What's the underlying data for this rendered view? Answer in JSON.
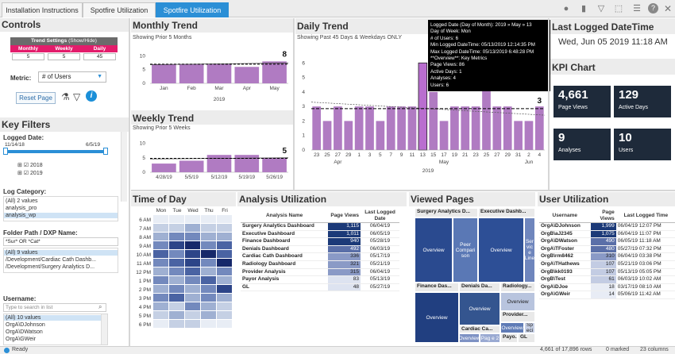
{
  "tabs": [
    {
      "label": "Installation Instructions"
    },
    {
      "label": "Spotfire Utilization v1.0"
    },
    {
      "label": "Spotfire Utilization v2.0"
    }
  ],
  "controls": {
    "title": "Controls",
    "trend_settings": "Trend Settings",
    "show_hide": "(Show/Hide)",
    "cols": [
      "Monthly",
      "Weekly",
      "Daily"
    ],
    "vals": [
      "5",
      "5",
      "45"
    ],
    "metric_label": "Metric:",
    "metric_value": "# of Users",
    "reset_label": "Reset Page"
  },
  "key_filters": {
    "title": "Key Filters",
    "logged_date_label": "Logged Date:",
    "date_from": "11/14/18",
    "date_to": "6/5/19",
    "years": [
      "2018",
      "2019"
    ],
    "log_category_label": "Log Category:",
    "log_category_items": [
      "(All) 2 values",
      "analysis_pro",
      "analysis_wp"
    ],
    "folder_label": "Folder Path / DXP Name:",
    "folder_search": "*Sur* OR *Cat*",
    "folder_items": [
      "(All) 9 values",
      "/Development/Cardiac Cath Dashb...",
      "/Development/Surgery Analytics D..."
    ],
    "username_label": "Username:",
    "username_placeholder": "Type to search in list",
    "username_items": [
      "(All) 10 values",
      "OrgA\\DJohnson",
      "OrgA\\DWatson",
      "OrgA\\GWeir"
    ]
  },
  "monthly": {
    "title": "Monthly Trend",
    "subtitle": "Showing Prior 5 Months",
    "chart_data": {
      "type": "bar",
      "categories": [
        "Jan",
        "Feb",
        "Mar",
        "Apr",
        "May"
      ],
      "values": [
        7,
        7,
        7,
        6,
        8
      ],
      "year": "2019",
      "yticks": [
        "10",
        "5",
        "0"
      ],
      "ylim": [
        0,
        11
      ],
      "last_label": "8"
    }
  },
  "weekly": {
    "title": "Weekly Trend",
    "subtitle": "Showing Prior 5 Weeks",
    "chart_data": {
      "type": "bar",
      "categories": [
        "4/28/19",
        "5/5/19",
        "5/12/19",
        "5/19/19",
        "5/26/19"
      ],
      "values": [
        3,
        4,
        6,
        6,
        5
      ],
      "yticks": [
        "10",
        "5",
        "0"
      ],
      "ylim": [
        0,
        11
      ],
      "last_label": "5"
    }
  },
  "daily": {
    "title": "Daily Trend",
    "subtitle": "Showing Past 45 Days & Weekdays ONLY",
    "chart_data": {
      "type": "bar",
      "categories": [
        "23",
        "25",
        "27",
        "29",
        "1",
        "3",
        "5",
        "7",
        "9",
        "11",
        "13",
        "15",
        "17",
        "19",
        "21",
        "23",
        "25",
        "27",
        "29",
        "31",
        "2",
        "4"
      ],
      "values": [
        3,
        2,
        3,
        2,
        3,
        3,
        2,
        3,
        3,
        3,
        6,
        4,
        2,
        3,
        3,
        3,
        6,
        3,
        3,
        2,
        2,
        3
      ],
      "months": [
        "Apr",
        "May",
        "Jun"
      ],
      "year": "2019",
      "yticks": [
        "6",
        "5",
        "4",
        "3",
        "2",
        "1",
        "0"
      ],
      "ylim": [
        0,
        7
      ],
      "last_label": "3",
      "highlight_index": 10
    },
    "tooltip": [
      "Logged Date (Day of Month): 2019 » May » 13",
      "Day of Week: Mon",
      "# of Users: 6",
      "Min Logged DateTime: 05/13/2019 12:14:35 PM",
      "Max Logged DateTime: 05/13/2019 6:48:28 PM",
      "**Overview**: Key Metrics",
      "Page Views: 86",
      "Active Days: 1",
      "Analyses: 4",
      "Users: 6"
    ]
  },
  "last_logged": {
    "title": "Last Logged DateTime",
    "value": "Wed, Jun 05 2019 11:18 AM"
  },
  "kpi": {
    "title": "KPI Chart",
    "tiles": [
      {
        "value": "4,661",
        "label": "Page Views"
      },
      {
        "value": "129",
        "label": "Active Days"
      },
      {
        "value": "9",
        "label": "Analyses"
      },
      {
        "value": "10",
        "label": "Users"
      }
    ]
  },
  "time_of_day": {
    "title": "Time of Day",
    "days": [
      "Mon",
      "Tue",
      "Wed",
      "Thu",
      "Fri"
    ],
    "hours": [
      "6 AM",
      "7 AM",
      "8 AM",
      "9 AM",
      "10 AM",
      "11 AM",
      "12 PM",
      "1 PM",
      "2 PM",
      "3 PM",
      "4 PM",
      "5 PM",
      "6 PM"
    ]
  },
  "analysis_util": {
    "title": "Analysis Utilization",
    "headers": [
      "Analysis Name",
      "Page Views",
      "Last Logged Date"
    ],
    "rows": [
      [
        "Surgery Analytics Dashboard",
        "1,115",
        "06/04/19"
      ],
      [
        "Executive Dashboard",
        "1,011",
        "06/05/19"
      ],
      [
        "Finance Dashboard",
        "940",
        "05/28/19"
      ],
      [
        "Denials Dashboard",
        "492",
        "06/03/19"
      ],
      [
        "Cardiac Cath Dashboard",
        "336",
        "05/17/19"
      ],
      [
        "Radiology Dashboard",
        "321",
        "05/21/19"
      ],
      [
        "Provider Analysis",
        "315",
        "06/04/19"
      ],
      [
        "Payor Analysis",
        "83",
        "05/13/19"
      ],
      [
        "GL",
        "48",
        "05/27/19"
      ]
    ]
  },
  "viewed_pages": {
    "title": "Viewed Pages",
    "labels": {
      "surg": "Surgery Analytics D...",
      "exec": "Executive Dashb...",
      "fin": "Finance Das...",
      "den": "Denials Da...",
      "rad": "Radiology...",
      "ov": "Overview",
      "peer": "Peer Compari son",
      "serv": "Ser vic e Line",
      "prov": "Provider...",
      "card": "Cardiac Ca...",
      "pag": "Pag e 2",
      "payo": "Payo...",
      "gl": "GL",
      "sp": "Sp eci"
    }
  },
  "user_util": {
    "title": "User Utilization",
    "headers": [
      "Username",
      "Page Views",
      "Last Logged Time"
    ],
    "rows": [
      [
        "OrgA\\DJohnson",
        "1,999",
        "06/04/19 12:07 PM"
      ],
      [
        "OrgB\\aJ2345",
        "1,075",
        "06/04/19 11:07 PM"
      ],
      [
        "OrgA\\DWatson",
        "490",
        "06/05/19 11:18 AM"
      ],
      [
        "OrgA\\TFoster",
        "480",
        "05/27/19 07:32 PM"
      ],
      [
        "OrgB\\rm8462",
        "310",
        "06/04/19 03:38 PM"
      ],
      [
        "OrgA\\THathews",
        "107",
        "05/21/19 03:06 PM"
      ],
      [
        "OrgB\\kk0193",
        "107",
        "05/13/19 05:05 PM"
      ],
      [
        "OrgB\\Test",
        "61",
        "06/03/19 10:02 AM"
      ],
      [
        "OrgA\\DJoe",
        "18",
        "03/17/19 08:10 AM"
      ],
      [
        "OrgA\\GWeir",
        "14",
        "05/06/19 11:42 AM"
      ]
    ]
  },
  "status": {
    "ready": "Ready",
    "rows": "4,661 of 17,896 rows",
    "marked": "0 marked",
    "cols": "23 columns"
  },
  "colors": {
    "bar": "#b07bc2",
    "tab_active": "#2b8fd6",
    "kpi_tile": "#1e2a3a",
    "tooltip_bg": "#000000"
  }
}
